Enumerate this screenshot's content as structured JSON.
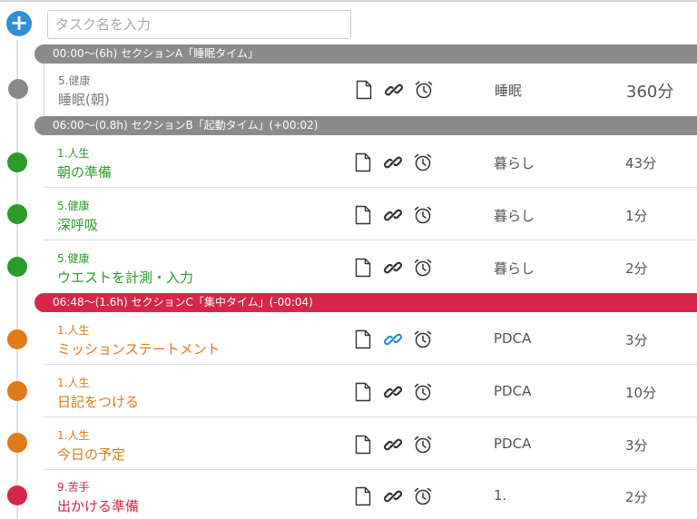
{
  "input": {
    "placeholder": "タスク名を入力"
  },
  "colors": {
    "gray": "#8a8a8a",
    "green": "#2e9a2e",
    "orange": "#e07a1a",
    "red": "#d8264a",
    "blue": "#2f8fd8"
  },
  "sections": [
    {
      "label": "00:00〜(6h) セクションA「睡眠タイム」"
    },
    {
      "label": "06:00〜(0.8h) セクションB「起動タイム」(+00:02)"
    },
    {
      "label": "06:48〜(1.6h) セクションC「集中タイム」(-00:04)"
    }
  ],
  "tasks": [
    {
      "category": "5.健康",
      "name": "睡眠(朝)",
      "mode": "睡眠",
      "minutes": "360分"
    },
    {
      "category": "1.人生",
      "name": "朝の準備",
      "mode": "暮らし",
      "minutes": "43分"
    },
    {
      "category": "5.健康",
      "name": "深呼吸",
      "mode": "暮らし",
      "minutes": "1分"
    },
    {
      "category": "5.健康",
      "name": "ウエストを計測・入力",
      "mode": "暮らし",
      "minutes": "2分"
    },
    {
      "category": "1.人生",
      "name": "ミッションステートメント",
      "mode": "PDCA",
      "minutes": "3分"
    },
    {
      "category": "1.人生",
      "name": "日記をつける",
      "mode": "PDCA",
      "minutes": "10分"
    },
    {
      "category": "1.人生",
      "name": "今日の予定",
      "mode": "PDCA",
      "minutes": "3分"
    },
    {
      "category": "9.苦手",
      "name": "出かける準備",
      "mode": "1.",
      "minutes": "2分"
    }
  ]
}
